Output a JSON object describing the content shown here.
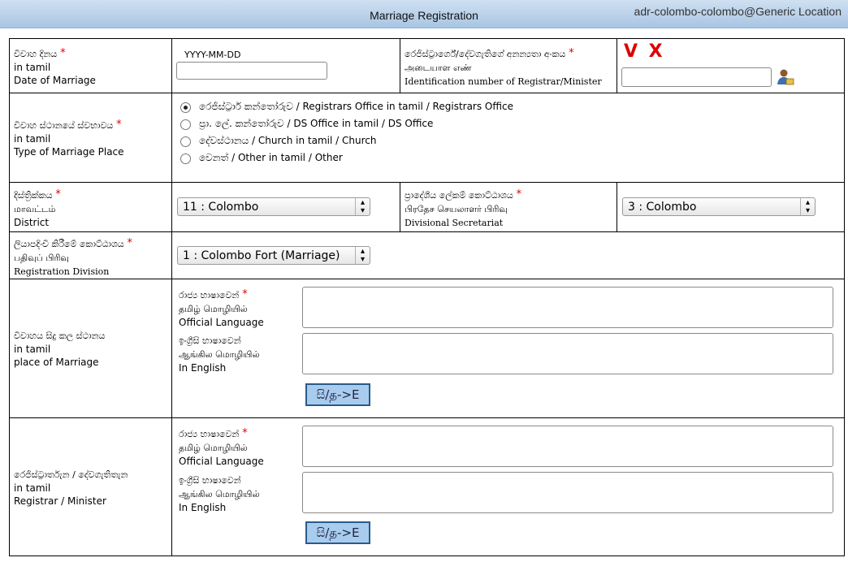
{
  "header": {
    "title": "Marriage Registration",
    "user_location": "adr-colombo-colombo@Generic Location"
  },
  "date_of_marriage": {
    "label_si": "විවාහ දිනය",
    "label_ta": "in tamil",
    "label_en": "Date of Marriage",
    "required": "*",
    "format_hint": "YYYY-MM-DD",
    "value": ""
  },
  "registrar_id": {
    "label_si": "රෙජිස්ට්‍රාර්ගේ/දේවගැතිගේ අනන්‍යතා අංකය",
    "label_ta": "அடையாள எண்",
    "label_en": "Identification number of Registrar/Minister",
    "required": "*",
    "vx": "V X",
    "value": ""
  },
  "marriage_place_type": {
    "label_si": "විවාහ ස්ථානයේ ස්වභාවය",
    "label_ta": "in tamil",
    "label_en": "Type of Marriage Place",
    "required": "*",
    "options": [
      {
        "label": "රෙජිස්ට්‍රාර් කන්තෝරුව / Registrars Office in tamil / Registrars Office",
        "selected": true
      },
      {
        "label": "ප්‍රා. ලේ. කන්තෝරුව / DS Office in tamil / DS Office",
        "selected": false
      },
      {
        "label": "දේවස්ථානය / Church in tamil / Church",
        "selected": false
      },
      {
        "label": "වෙනත් / Other in tamil / Other",
        "selected": false
      }
    ]
  },
  "district": {
    "label_si": "දිස්ත්‍රික්කය",
    "label_ta": "மாவட்டம்",
    "label_en": "District",
    "required": "*",
    "selected": "11 : Colombo"
  },
  "ds_division": {
    "label_si": "ප්‍රාදේශීය ලේකම් කොට්ඨාශය",
    "label_ta": "பிரதேச செயலாளர் பிரிவு",
    "label_en": "Divisional Secretariat",
    "required": "*",
    "selected": "3 : Colombo"
  },
  "registration_division": {
    "label_si": "ලියාපදිංචි කිරීමේ කොට්ඨාශය",
    "label_ta": "பதிவுப் பிரிவு",
    "label_en": "Registration Division",
    "required": "*",
    "selected": "1 : Colombo Fort (Marriage)"
  },
  "place_of_marriage": {
    "label_si": "විවාහය සිදු කල ස්ථානය",
    "label_ta": "in tamil",
    "label_en": "place of Marriage",
    "official_si": "රාජ්‍ය භාෂාවෙන්",
    "official_ta": "தமிழ் மொழியில்",
    "official_en": "Official Language",
    "english_si": "ඉංග්‍රීසි භාෂාවෙන්",
    "english_ta": "ஆங்கில மொழியில்",
    "english_en": "In English",
    "required": "*",
    "convert_label": "සි/த->E"
  },
  "registrar_minister": {
    "label_si": "රෙජිස්ට්‍රාර්තැන / දේවගැතිතැන",
    "label_ta": "in tamil",
    "label_en": "Registrar / Minister",
    "official_si": "රාජ්‍ය භාෂාවෙන්",
    "official_ta": "தமிழ் மொழியில்",
    "official_en": "Official Language",
    "english_si": "ඉංග්‍රීසි භාෂාවෙන්",
    "english_ta": "ஆங்கில மொழியில்",
    "english_en": "In English",
    "required": "*",
    "convert_label": "සි/த->E"
  },
  "colors": {
    "header_bg": "#b9d1ea",
    "required": "#dd0000",
    "convert_bg": "#a8ccee",
    "vx": "#dd0000"
  },
  "icons": [
    "person-lookup-icon",
    "radio-icon",
    "dropdown-arrow-icon"
  ]
}
